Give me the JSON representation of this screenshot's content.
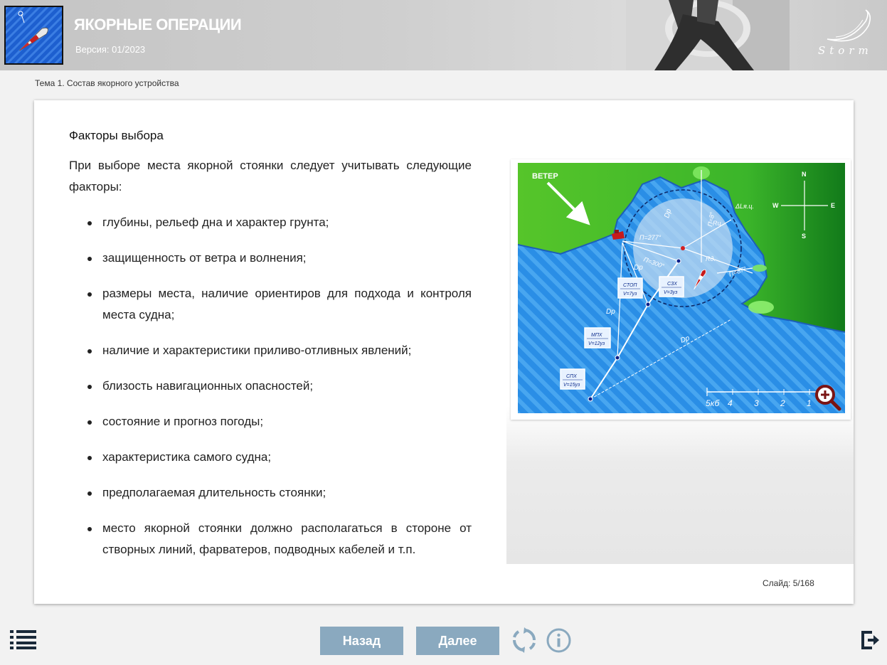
{
  "header": {
    "title": "ЯКОРНЫЕ ОПЕРАЦИИ",
    "version": "Версия: 01/2023",
    "brand": "Storm"
  },
  "breadcrumb": "Тема 1. Состав якорного устройства",
  "content": {
    "section_title": "Факторы выбора",
    "intro": "При выборе места якорной стоянки следует учитывать следующие факторы:",
    "factors": [
      "глубины, рельеф дна и характер грунта;",
      "защищенность от ветра и волнения;",
      "размеры места, наличие ориентиров для подхода и контроля места судна;",
      "наличие и характеристики приливо-отливных явлений;",
      "близость навигационных опасностей;",
      "состояние и прогноз погоды;",
      "характеристика самого судна;",
      "предполагаемая длительность стоянки;",
      "место якорной стоянки должно располагаться в стороне от створных линий, фарватеров, подводных кабелей и т.п."
    ]
  },
  "diagram": {
    "wind_label": "ВЕТЕР",
    "compass": {
      "n": "N",
      "s": "S",
      "w": "W",
      "e": "E"
    },
    "bearings": [
      "П=277°",
      "П=300°",
      "П=87°",
      "П=8°"
    ],
    "distance_labels": [
      "Dp",
      "Dp",
      "Dp",
      "Dp",
      "Dp"
    ],
    "radius_labels": [
      "Rд.",
      "Rц",
      "ΔLя.ц."
    ],
    "boxes": [
      {
        "label": "СТОП",
        "speed": "V=7уз"
      },
      {
        "label": "СЗХ",
        "speed": "V=3уз"
      },
      {
        "label": "МПХ",
        "speed": "V=12уз"
      },
      {
        "label": "СПХ",
        "speed": "V=15уз"
      }
    ],
    "scale": [
      "5кб",
      "4",
      "3",
      "2",
      "1"
    ]
  },
  "slide": {
    "label": "Слайд:",
    "current": "5",
    "total": "/168"
  },
  "nav": {
    "back": "Назад",
    "next": "Далее"
  },
  "colors": {
    "button": "#8aa9bf",
    "sea": "#2a8ee6",
    "land": "#4cc02a",
    "accent": "#8b1a1a"
  }
}
